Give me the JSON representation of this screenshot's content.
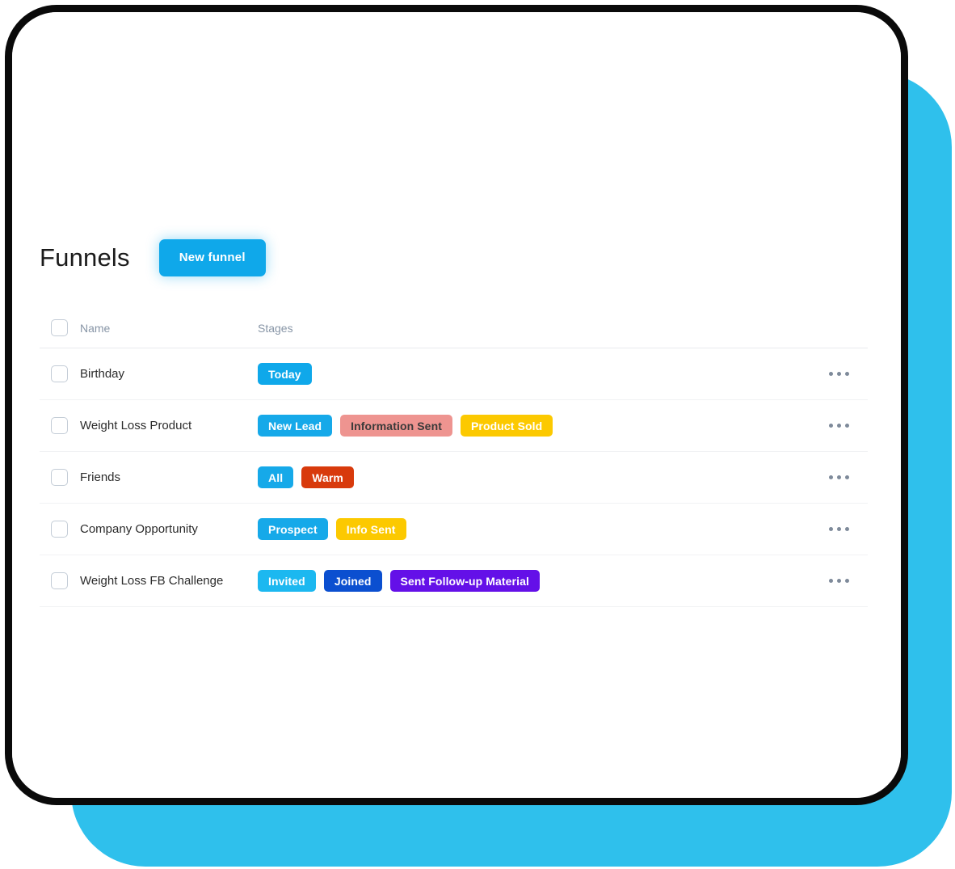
{
  "header": {
    "title": "Funnels",
    "new_funnel_label": "New funnel"
  },
  "table": {
    "columns": {
      "name": "Name",
      "stages": "Stages"
    },
    "rows": [
      {
        "name": "Birthday",
        "stages": [
          {
            "label": "Today",
            "bg": "#0fa8ea",
            "fg": "#ffffff"
          }
        ]
      },
      {
        "name": "Weight Loss Product",
        "stages": [
          {
            "label": "New Lead",
            "bg": "#16a9e9",
            "fg": "#ffffff"
          },
          {
            "label": "Information Sent",
            "bg": "#ee9490",
            "fg": "#3a3a3a"
          },
          {
            "label": "Product Sold",
            "bg": "#fcc900",
            "fg": "#ffffff"
          }
        ]
      },
      {
        "name": "Friends",
        "stages": [
          {
            "label": "All",
            "bg": "#16a9e9",
            "fg": "#ffffff"
          },
          {
            "label": "Warm",
            "bg": "#d83a0c",
            "fg": "#ffffff"
          }
        ]
      },
      {
        "name": "Company Opportunity",
        "stages": [
          {
            "label": "Prospect",
            "bg": "#16a9e9",
            "fg": "#ffffff"
          },
          {
            "label": "Info Sent",
            "bg": "#fcc900",
            "fg": "#ffffff"
          }
        ]
      },
      {
        "name": "Weight Loss FB Challenge",
        "stages": [
          {
            "label": "Invited",
            "bg": "#1cb8f0",
            "fg": "#ffffff"
          },
          {
            "label": "Joined",
            "bg": "#0b4fd0",
            "fg": "#ffffff"
          },
          {
            "label": "Sent Follow-up Material",
            "bg": "#6410e8",
            "fg": "#ffffff"
          }
        ]
      }
    ],
    "row_menu_icon": "ellipsis-icon"
  },
  "theme": {
    "accent_cyan": "#2fc0ec",
    "primary_blue": "#0fa8ea",
    "frame_black": "#0a0a0a",
    "divider": "#f1f2f4",
    "muted_text": "#8795a6"
  }
}
